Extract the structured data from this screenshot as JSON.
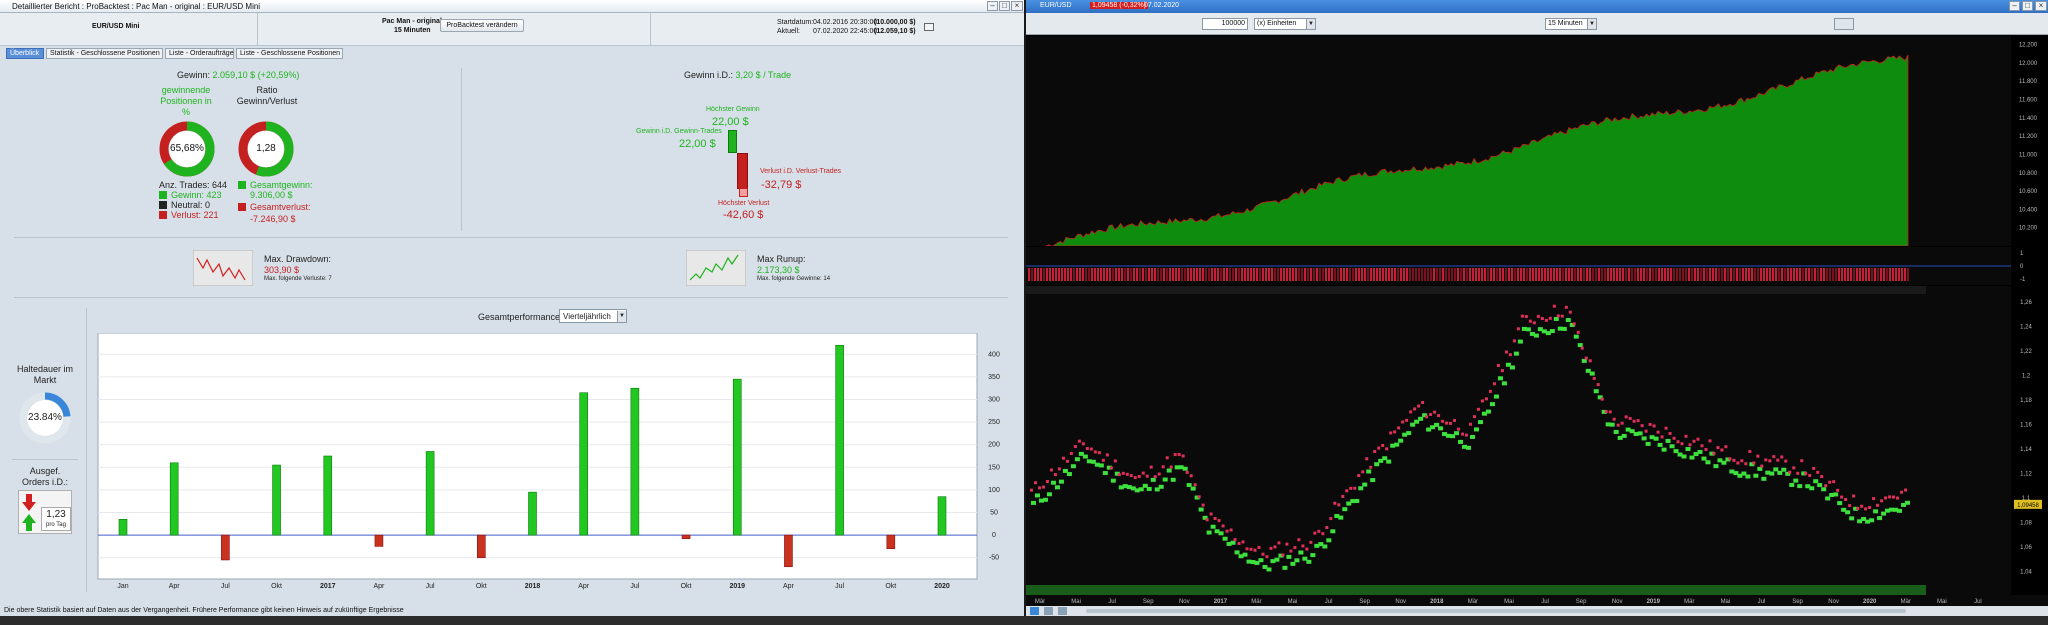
{
  "left_window": {
    "title": "Detaillierter Bericht : ProBacktest : Pac Man - original : EUR/USD Mini",
    "header": {
      "instrument": "EUR/USD Mini",
      "strategy_name": "Pac Man - original",
      "timeframe": "15 Minuten",
      "change_button": "ProBacktest verändern",
      "start_label": "Startdatum:",
      "start_value": "04.02.2016 20:30:00",
      "start_amount": "(10.000,00 $)",
      "current_label": "Aktuell:",
      "current_value": "07.02.2020 22:45:00",
      "current_amount": "(12.059,10 $)"
    },
    "tabs": [
      "Überblick",
      "Statistik - Geschlossene Positionen",
      "Liste - Orderaufträge",
      "Liste - Geschlossene Positionen"
    ],
    "summary": {
      "gain_label": "Gewinn:",
      "gain_value": "2.059,10 $ (+20,59%)",
      "won_positions_label": "gewinnende Positionen in %",
      "ratio_label": "Ratio Gewinn/Verlust",
      "won_pct": "65,68%",
      "ratio_value": "1,28",
      "won_fraction": 0.6568,
      "ratio_fraction": 0.56,
      "trades_label": "Anz. Trades:",
      "trades_count": "644",
      "win_label": "Gewinn:",
      "win_count": "423",
      "neutral_label": "Neutral:",
      "neutral_count": "0",
      "loss_label": "Verlust:",
      "loss_count": "221",
      "total_gain_label": "Gesamtgewinn:",
      "total_gain_value": "9.306,00 $",
      "total_loss_label": "Gesamtverlust:",
      "total_loss_value": "-7.246,90 $"
    },
    "per_trade": {
      "label": "Gewinn i.D.:",
      "value": "3,20 $ / Trade",
      "max_gain_label": "Höchster Gewinn",
      "max_gain_value": "22,00 $",
      "avg_gain_label": "Gewinn i.D. Gewinn-Trades",
      "avg_gain_value": "22,00 $",
      "avg_loss_label": "Verlust i.D. Verlust-Trades",
      "avg_loss_value": "-32,79 $",
      "max_loss_label": "Höchster Verlust",
      "max_loss_value": "-42,60 $"
    },
    "drawdown": {
      "label": "Max. Drawdown:",
      "value": "303,90 $",
      "sub": "Max. folgende Verluste: 7"
    },
    "runup": {
      "label": "Max Runup:",
      "value": "2.173,30 $",
      "sub": "Max. folgende Gewinne: 14"
    },
    "market_time": {
      "label": "Haltedauer im Markt",
      "value": "23.84%",
      "fraction": 0.2384
    },
    "orders": {
      "label": "Ausgef. Orders i.D.:",
      "value": "1,23",
      "unit": "pro Tag"
    },
    "performance": {
      "label": "Gesamtperformance",
      "select_value": "Vierteljährlich"
    },
    "footer": "Die obere Statistik basiert auf Daten aus der Vergangenheit. Frühere Performance gibt keinen Hinweis auf zukünftige Ergebnisse"
  },
  "chart_data": [
    {
      "type": "bar",
      "title": "Gesamtperformance",
      "categories": [
        "Jan",
        "Apr",
        "Jul",
        "Okt",
        "2017",
        "Apr",
        "Jul",
        "Okt",
        "2018",
        "Apr",
        "Jul",
        "Okt",
        "2019",
        "Apr",
        "Jul",
        "Okt",
        "2020"
      ],
      "values": [
        35,
        160,
        -55,
        155,
        175,
        -25,
        185,
        -50,
        95,
        315,
        325,
        -8,
        345,
        -70,
        420,
        -30,
        85
      ],
      "ylim": [
        -75,
        425
      ],
      "yticks": [
        -50,
        0,
        50,
        100,
        150,
        200,
        250,
        300,
        350,
        400
      ],
      "positive_color": "#22c722",
      "negative_color": "#c8321e"
    },
    {
      "type": "area",
      "title": "",
      "yticks": [
        "10.200",
        "10.400",
        "10.600",
        "10.800",
        "11.000",
        "11.200",
        "11.400",
        "11.600",
        "11.800",
        "12.000",
        "12.200"
      ],
      "ylim": [
        10000,
        12250
      ],
      "last_value": "12.059,10"
    },
    {
      "type": "scatter",
      "title": "",
      "yticks": [
        "1,04",
        "1,06",
        "1,08",
        "1,1",
        "1,12",
        "1,14",
        "1,16",
        "1,18",
        "1,2",
        "1,22",
        "1,24",
        "1,26"
      ],
      "ylim": [
        1.03,
        1.265
      ],
      "last_value": "1,09458"
    }
  ],
  "right_window": {
    "instrument": "EUR/USD",
    "price_badge": "1,09458 (-0,32%)",
    "date": "07.02.2020",
    "quantity": "100000",
    "unit_select": "(x) Einheiten",
    "timeframe_select": "15 Minuten",
    "x_labels": [
      "Mär",
      "Mai",
      "Jul",
      "Sep",
      "Nov",
      "2017",
      "Mär",
      "Mai",
      "Jul",
      "Sep",
      "Nov",
      "2018",
      "Mär",
      "Mai",
      "Jul",
      "Sep",
      "Nov",
      "2019",
      "Mär",
      "Mai",
      "Jul",
      "Sep",
      "Nov",
      "2020",
      "Mär",
      "Mai",
      "Jul"
    ],
    "marker_scale_top": "1",
    "marker_scale_mid": "0",
    "marker_scale_bot": "-1"
  },
  "colors": {
    "gain_green": "#1fb31f",
    "loss_red": "#c52020",
    "equity_green": "#0e8c0e",
    "equity_red": "#c81e1e"
  }
}
